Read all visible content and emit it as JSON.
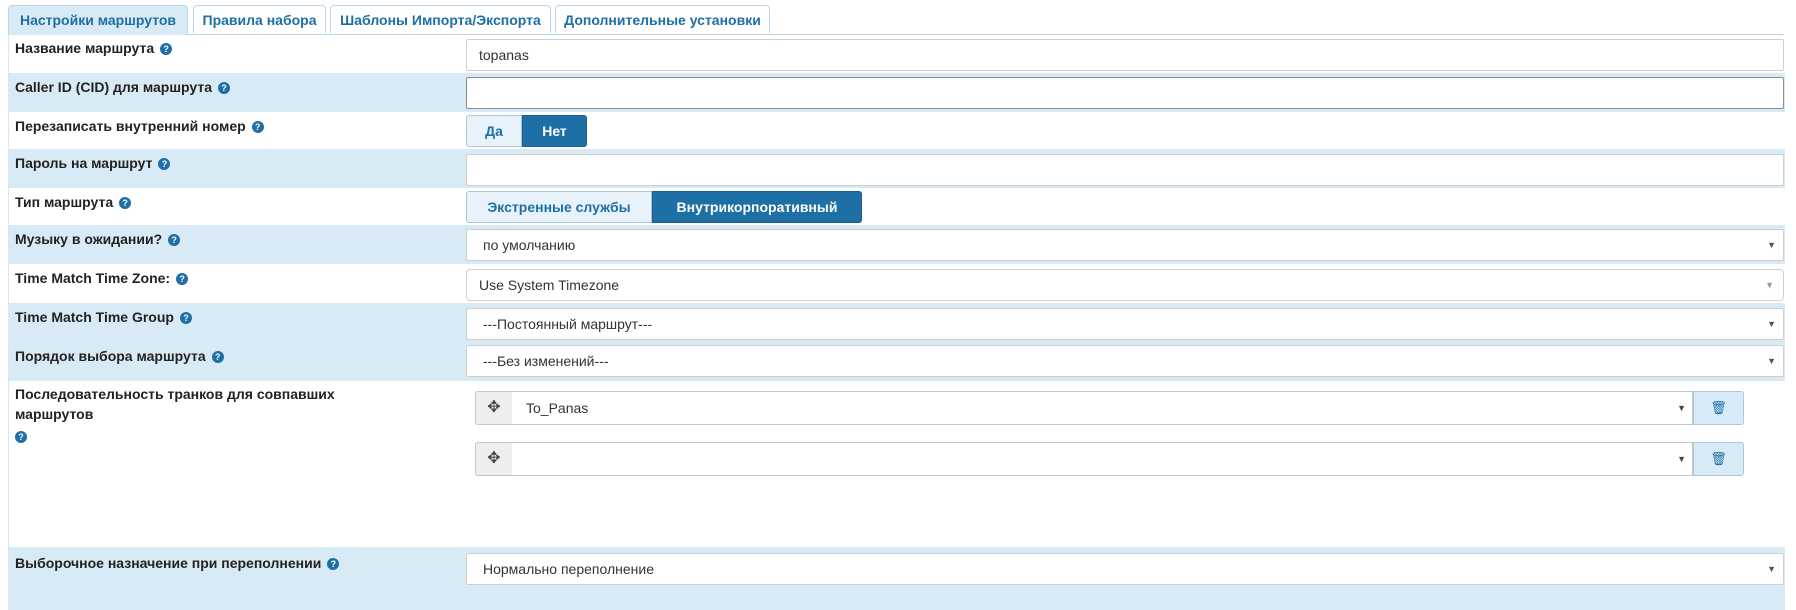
{
  "tabs": [
    {
      "label": "Настройки маршрутов"
    },
    {
      "label": "Правила набора"
    },
    {
      "label": "Шаблоны Импорта/Экспорта"
    },
    {
      "label": "Дополнительные установки"
    }
  ],
  "active_tab": "Настройки маршрутов",
  "fields": {
    "route_name": {
      "label": "Название маршрута",
      "value": "topanas"
    },
    "caller_id": {
      "label": "Caller ID (CID) для маршрута",
      "value": ""
    },
    "override_extension": {
      "label": "Перезаписать внутренний номер",
      "options": [
        "Да",
        "Нет"
      ],
      "selected": "Нет"
    },
    "route_password": {
      "label": "Пароль на маршрут",
      "value": ""
    },
    "route_type": {
      "label": "Тип маршрута",
      "options": [
        "Экстренные службы",
        "Внутрикорпоративный"
      ],
      "selected": "Внутрикорпоративный"
    },
    "music_on_hold": {
      "label": "Музыку в ожидании?",
      "value": "по умолчанию"
    },
    "time_zone": {
      "label": "Time Match Time Zone:",
      "value": "Use System Timezone"
    },
    "time_group": {
      "label": "Time Match Time Group",
      "value": "---Постоянный маршрут---"
    },
    "route_position": {
      "label": "Порядок выбора маршрута",
      "value": "---Без изменений---"
    },
    "trunk_sequence": {
      "label_line1": "Последовательность транков для совпавших",
      "label_line2": "маршрутов",
      "trunks": [
        "To_Panas",
        ""
      ]
    },
    "overflow_destination": {
      "label": "Выборочное назначение при переполнении",
      "value": "Нормально переполнение"
    }
  },
  "icons": {
    "help": "question-circle-icon",
    "move": "move-arrows-icon",
    "delete": "trash-icon",
    "caret": "caret-down-icon"
  },
  "colors": {
    "accent": "#1d6fa5",
    "row_alt": "#d9eaf7"
  }
}
